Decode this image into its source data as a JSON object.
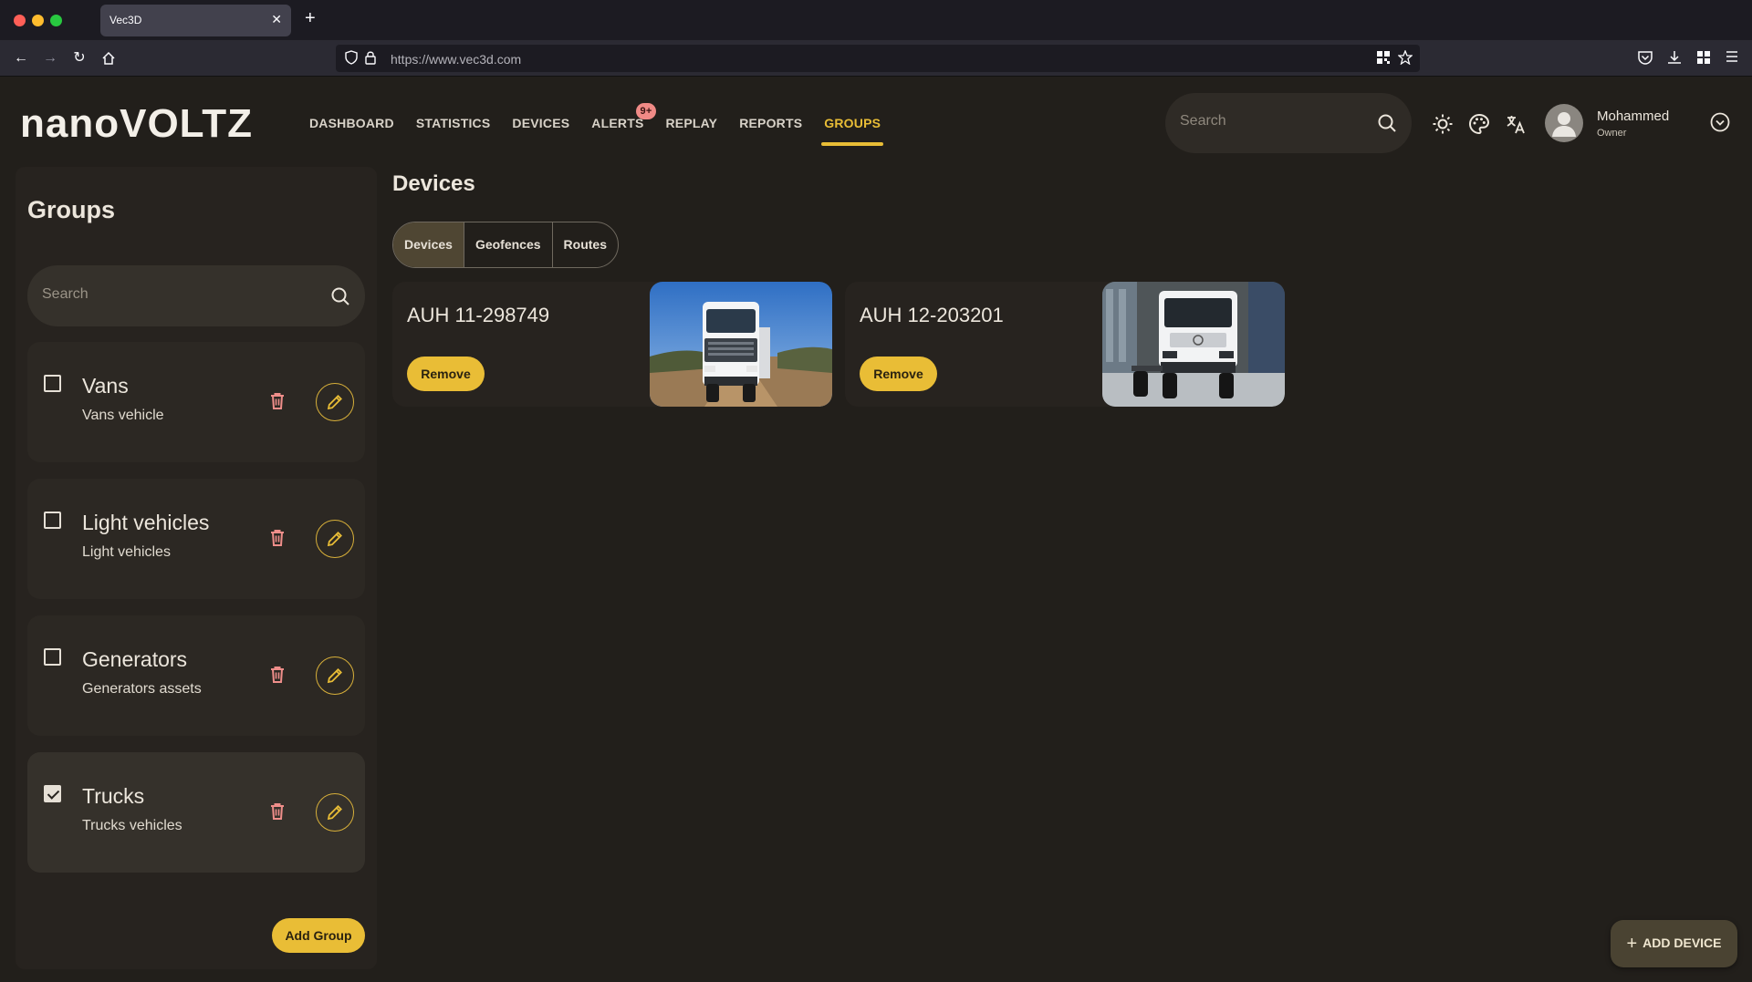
{
  "browser": {
    "tab_title": "Vec3D",
    "url": "https://www.vec3d.com"
  },
  "header": {
    "logo": "nanoVOLTZ",
    "nav": [
      {
        "label": "DASHBOARD"
      },
      {
        "label": "STATISTICS"
      },
      {
        "label": "DEVICES"
      },
      {
        "label": "ALERTS",
        "badge": "9+"
      },
      {
        "label": "REPLAY"
      },
      {
        "label": "REPORTS"
      },
      {
        "label": "GROUPS",
        "active": true
      }
    ],
    "search_placeholder": "Search",
    "user": {
      "name": "Mohammed",
      "role": "Owner"
    }
  },
  "groups_panel": {
    "title": "Groups",
    "search_placeholder": "Search",
    "groups": [
      {
        "name": "Vans",
        "description": "Vans vehicle",
        "checked": false
      },
      {
        "name": "Light vehicles",
        "description": "Light vehicles",
        "checked": false
      },
      {
        "name": "Generators",
        "description": "Generators assets",
        "checked": false
      },
      {
        "name": "Trucks",
        "description": "Trucks vehicles",
        "checked": true
      }
    ],
    "add_label": "Add Group"
  },
  "main": {
    "title": "Devices",
    "tabs": [
      {
        "label": "Devices",
        "active": true
      },
      {
        "label": "Geofences"
      },
      {
        "label": "Routes"
      }
    ],
    "devices": [
      {
        "name": "AUH 11-298749",
        "remove_label": "Remove"
      },
      {
        "name": "AUH 12-203201",
        "remove_label": "Remove"
      }
    ],
    "add_device_label": "ADD DEVICE"
  },
  "colors": {
    "accent": "#e9bd36",
    "background": "#221f1b",
    "badge": "#f08a86",
    "delete_icon": "#ef8e8a"
  }
}
